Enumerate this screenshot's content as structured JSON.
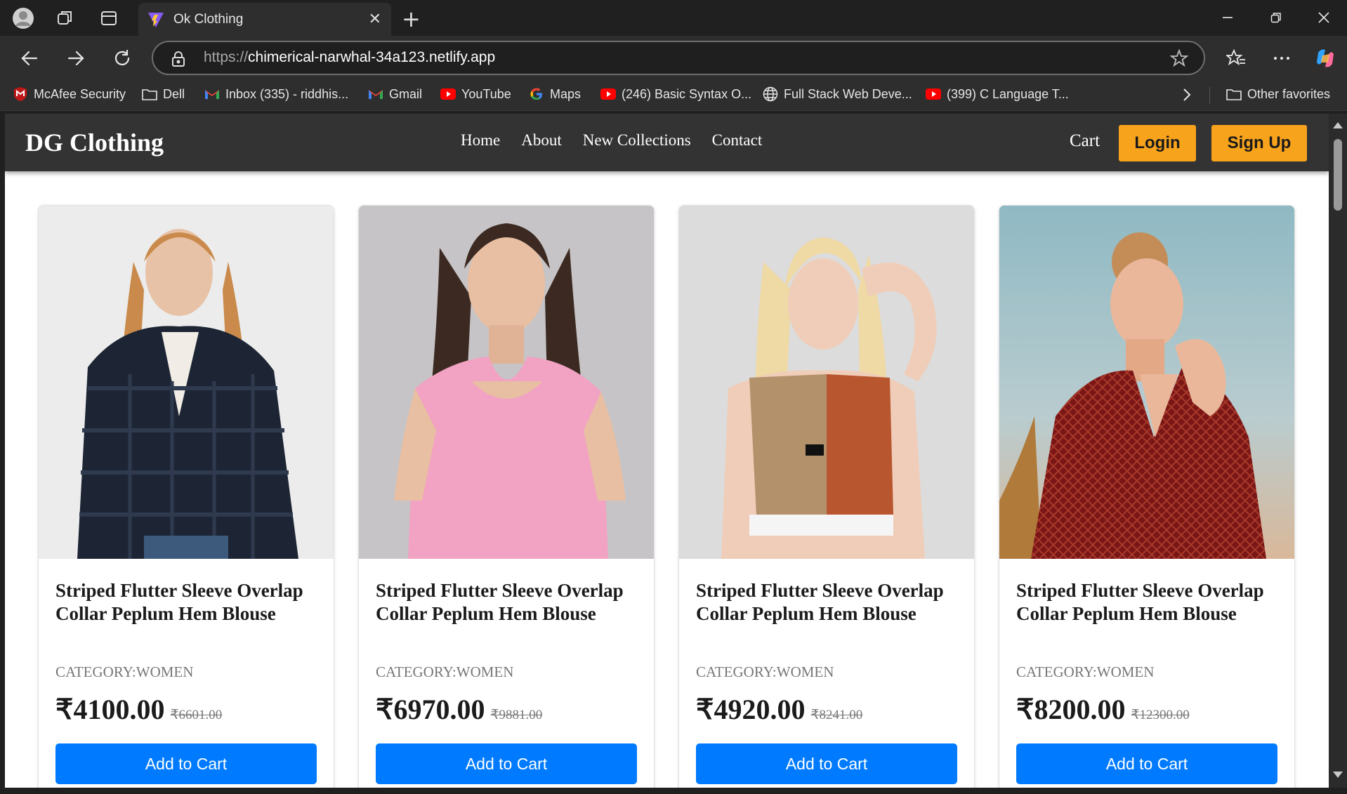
{
  "browser": {
    "tab_title": "Ok Clothing",
    "url_prefix": "https://",
    "url_host": "chimerical-narwhal-34a123.netlify.app"
  },
  "bookmarks": [
    {
      "label": "McAfee Security",
      "icon": "mcafee-icon"
    },
    {
      "label": "Dell",
      "icon": "folder-icon"
    },
    {
      "label": "Inbox (335) - riddhis...",
      "icon": "gmail-icon"
    },
    {
      "label": "Gmail",
      "icon": "gmail-icon"
    },
    {
      "label": "YouTube",
      "icon": "youtube-icon"
    },
    {
      "label": "Maps",
      "icon": "google-icon"
    },
    {
      "label": "(246) Basic Syntax O...",
      "icon": "youtube-icon"
    },
    {
      "label": "Full Stack Web Deve...",
      "icon": "globe-icon"
    },
    {
      "label": "(399) C Language T...",
      "icon": "youtube-icon"
    }
  ],
  "other_favorites": "Other favorites",
  "site": {
    "brand": "DG Clothing",
    "nav": [
      "Home",
      "About",
      "New Collections",
      "Contact"
    ],
    "cart": "Cart",
    "login": "Login",
    "signup": "Sign Up"
  },
  "colors": {
    "header_bg": "#333333",
    "accent_orange": "#f7a31c",
    "button_blue": "#007bff"
  },
  "products": [
    {
      "title": "Striped Flutter Sleeve Overlap Collar Peplum Hem Blouse",
      "category": "CATEGORY:WOMEN",
      "price": "₹4100.00",
      "old_price": "₹6601.00",
      "button": "Add to Cart",
      "image": "woman-in-navy-fur-jacket"
    },
    {
      "title": "Striped Flutter Sleeve Overlap Collar Peplum Hem Blouse",
      "category": "CATEGORY:WOMEN",
      "price": "₹6970.00",
      "old_price": "₹9881.00",
      "button": "Add to Cart",
      "image": "woman-in-pink-top"
    },
    {
      "title": "Striped Flutter Sleeve Overlap Collar Peplum Hem Blouse",
      "category": "CATEGORY:WOMEN",
      "price": "₹4920.00",
      "old_price": "₹8241.00",
      "button": "Add to Cart",
      "image": "woman-in-sports-crop-top"
    },
    {
      "title": "Striped Flutter Sleeve Overlap Collar Peplum Hem Blouse",
      "category": "CATEGORY:WOMEN",
      "price": "₹8200.00",
      "old_price": "₹12300.00",
      "button": "Add to Cart",
      "image": "woman-in-red-patterned-dress"
    }
  ]
}
